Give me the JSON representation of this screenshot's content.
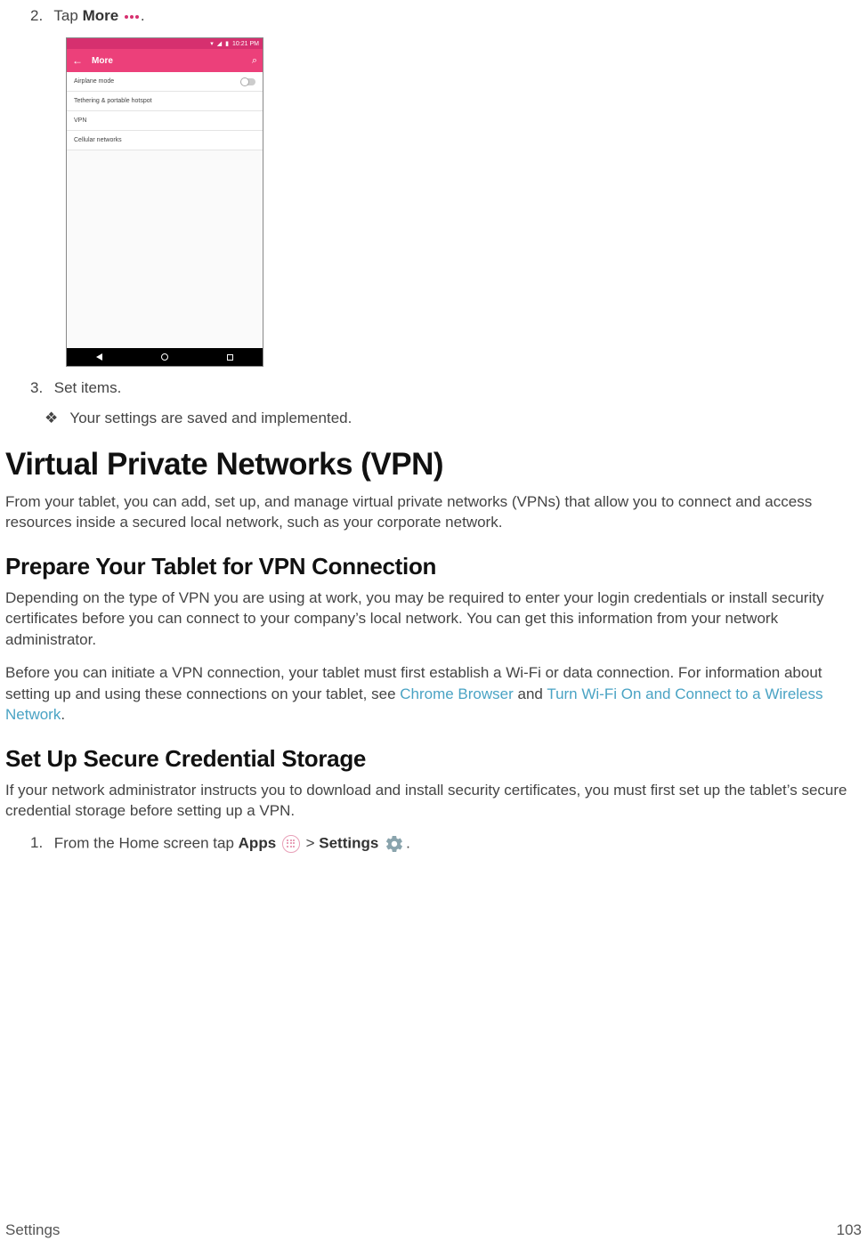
{
  "steps": {
    "s2": {
      "num": "2.",
      "pre": "Tap ",
      "bold": "More",
      "post": "."
    },
    "s3": {
      "num": "3.",
      "text": "Set items."
    }
  },
  "bullet": {
    "mark": "❖",
    "text": "Your settings are saved and implemented."
  },
  "h1": "Virtual Private Networks (VPN)",
  "p1": "From your tablet, you can add, set up, and manage virtual private networks (VPNs) that allow you to connect and access resources inside a secured local network, such as your corporate network.",
  "h2a": "Prepare Your Tablet for VPN Connection",
  "p2": "Depending on the type of VPN you are using at work, you may be required to enter your login credentials or install security certificates before you can connect to your company’s local network. You can get this information from your network administrator.",
  "p3": {
    "a": "Before you can initiate a VPN connection, your tablet must first establish a Wi-Fi or data connection. For information about setting up and using these connections on your tablet, see ",
    "link1": "Chrome Browser",
    "b": " and ",
    "link2": "Turn Wi-Fi On and Connect to a Wireless Network",
    "c": "."
  },
  "h2b": "Set Up Secure Credential Storage",
  "p4": "If your network administrator instructs you to download and install security certificates, you must first set up the tablet’s secure credential storage before setting up a VPN.",
  "ol1": {
    "num": "1.",
    "a": "From the Home screen tap ",
    "apps": "Apps",
    "gt": " > ",
    "settings": "Settings",
    "end": "."
  },
  "phone": {
    "time": "10:21 PM",
    "title": "More",
    "rows": [
      "Airplane mode",
      "Tethering & portable hotspot",
      "VPN",
      "Cellular networks"
    ]
  },
  "footer": {
    "left": "Settings",
    "right": "103"
  }
}
